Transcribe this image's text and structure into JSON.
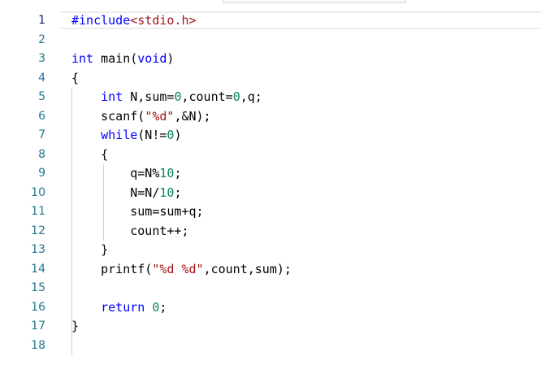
{
  "editor": {
    "line_numbers": [
      "1",
      "2",
      "3",
      "4",
      "5",
      "6",
      "7",
      "8",
      "9",
      "10",
      "11",
      "12",
      "13",
      "14",
      "15",
      "16",
      "17",
      "18"
    ],
    "lines": [
      [
        {
          "t": "#include",
          "c": "inc"
        },
        {
          "t": "<stdio.h>",
          "c": "hdr"
        }
      ],
      [],
      [
        {
          "t": "int",
          "c": "kw"
        },
        {
          "t": " main(",
          "c": ""
        },
        {
          "t": "void",
          "c": "kw"
        },
        {
          "t": ")",
          "c": ""
        }
      ],
      [
        {
          "t": "{",
          "c": ""
        }
      ],
      [
        {
          "t": "    ",
          "c": ""
        },
        {
          "t": "int",
          "c": "kw"
        },
        {
          "t": " N,sum=",
          "c": ""
        },
        {
          "t": "0",
          "c": "num"
        },
        {
          "t": ",count=",
          "c": ""
        },
        {
          "t": "0",
          "c": "num"
        },
        {
          "t": ",q;",
          "c": ""
        }
      ],
      [
        {
          "t": "    scanf(",
          "c": ""
        },
        {
          "t": "\"%d\"",
          "c": "str"
        },
        {
          "t": ",&N);",
          "c": ""
        }
      ],
      [
        {
          "t": "    ",
          "c": ""
        },
        {
          "t": "while",
          "c": "kw"
        },
        {
          "t": "(N!=",
          "c": ""
        },
        {
          "t": "0",
          "c": "num"
        },
        {
          "t": ")",
          "c": ""
        }
      ],
      [
        {
          "t": "    {",
          "c": ""
        }
      ],
      [
        {
          "t": "        q=N%",
          "c": ""
        },
        {
          "t": "10",
          "c": "num"
        },
        {
          "t": ";",
          "c": ""
        }
      ],
      [
        {
          "t": "        N=N/",
          "c": ""
        },
        {
          "t": "10",
          "c": "num"
        },
        {
          "t": ";",
          "c": ""
        }
      ],
      [
        {
          "t": "        sum=sum+q;",
          "c": ""
        }
      ],
      [
        {
          "t": "        count++;",
          "c": ""
        }
      ],
      [
        {
          "t": "    }",
          "c": ""
        }
      ],
      [
        {
          "t": "    printf(",
          "c": ""
        },
        {
          "t": "\"%d %d\"",
          "c": "str"
        },
        {
          "t": ",count,sum);",
          "c": ""
        }
      ],
      [],
      [
        {
          "t": "    ",
          "c": ""
        },
        {
          "t": "return",
          "c": "kw"
        },
        {
          "t": " ",
          "c": ""
        },
        {
          "t": "0",
          "c": "num"
        },
        {
          "t": ";",
          "c": ""
        }
      ],
      [
        {
          "t": "}",
          "c": ""
        }
      ],
      []
    ],
    "colors": {
      "keyword": "#0000ff",
      "string": "#a31515",
      "number": "#098658",
      "line_number": "#237893",
      "active_line_number": "#0b216f"
    }
  }
}
